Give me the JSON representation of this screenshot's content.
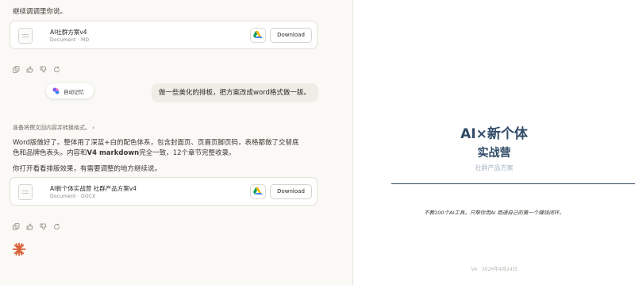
{
  "chat": {
    "top_text": "继续调调里你说。",
    "file1": {
      "title": "AI社群方案v4",
      "type": "Document",
      "ext": "MD",
      "download": "Download"
    },
    "memory_label": "自动记忆",
    "user_message": "做一些美化的排板，把方案改成word格式做一版。",
    "thinking": "准备将撰文回内容并转换格式。",
    "reply_line1_a": "Word",
    "reply_line1_b": "版做好了。整体用了深蓝+白的配色体系，包含封面页、页眉页脚页码，表格都做了交替底",
    "reply_line2_a": "色和品牌色表头。内容和",
    "reply_line2_bold": "V4 markdown",
    "reply_line2_b": "完全一致，12个章节完整收录。",
    "reply_line3": "你打开看看排版效果，有需要调整的地方继续说。",
    "file2": {
      "title": "AI新个体实战营 社群产品方案v4",
      "type": "Document",
      "ext": "DOCX",
      "download": "Download"
    }
  },
  "preview": {
    "title_line1": "AI×新个体",
    "title_line2": "实战营",
    "subtitle": "社群产品方案",
    "quote": "不教100个AI工具，只帮你用AI 跑通自己的第一个赚钱闭环。",
    "footer": "V4 · 2026年4月24日"
  },
  "colors": {
    "brand": "#2f4a66",
    "accent": "#d9613a",
    "drive_blue": "#4285f4",
    "drive_green": "#0f9d58",
    "drive_yellow": "#f4b400"
  }
}
